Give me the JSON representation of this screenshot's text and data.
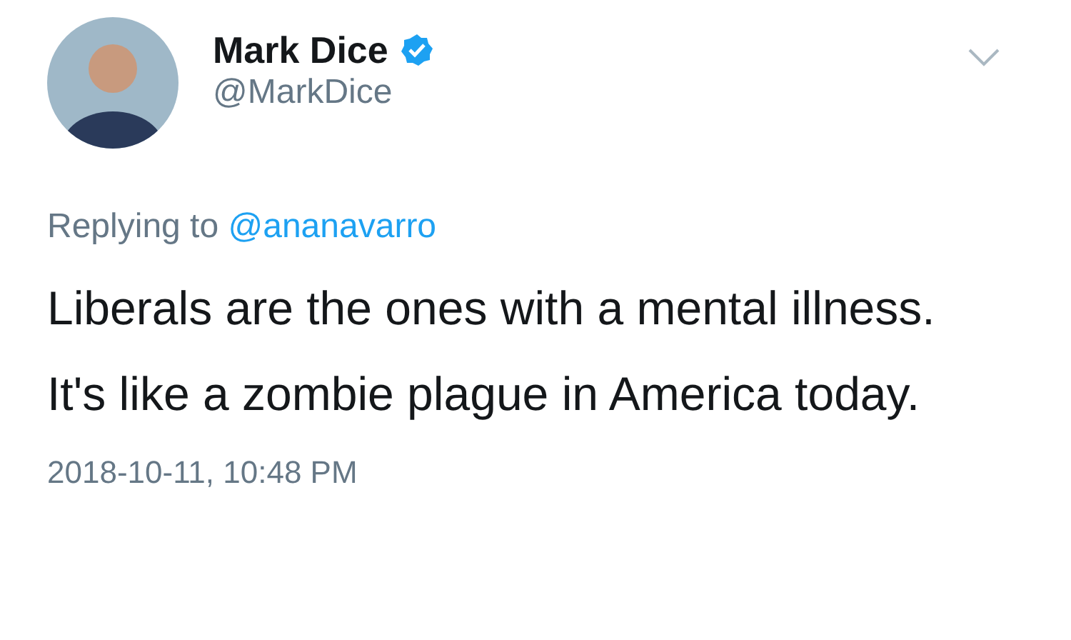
{
  "author": {
    "name": "Mark Dice",
    "verified": true,
    "handle": "@MarkDice"
  },
  "reply_context": {
    "label": "Replying to",
    "handle": "@ananavarro"
  },
  "text": "Liberals are the ones with a mental illness.  It's like a zombie plague in America today.",
  "timestamp": "2018-10-11, 10:48 PM"
}
